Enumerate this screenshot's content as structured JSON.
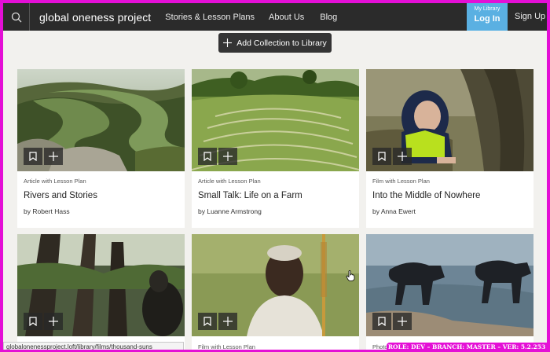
{
  "nav": {
    "logo": "global oneness project",
    "links": [
      "Stories & Lesson Plans",
      "About Us",
      "Blog"
    ],
    "library_label": "My Library",
    "login_label": "Log In",
    "signup_label": "Sign Up"
  },
  "toolbar": {
    "add_collection_label": "Add Collection to Library"
  },
  "cards": [
    {
      "type": "Article with Lesson Plan",
      "title": "Rivers and Stories",
      "author": "by Robert Hass"
    },
    {
      "type": "Article with Lesson Plan",
      "title": "Small Talk: Life on a Farm",
      "author": "by Luanne Armstrong"
    },
    {
      "type": "Film with Lesson Plan",
      "title": "Into the Middle of Nowhere",
      "author": "by Anna Ewert"
    },
    {
      "type": "",
      "title": "",
      "author": ""
    },
    {
      "type": "Film with Lesson Plan",
      "title": "",
      "author": ""
    },
    {
      "type": "Photo",
      "title": "",
      "author": ""
    }
  ],
  "status_bar": {
    "url": "globalonenessproject.loft/library/films/thousand-suns"
  },
  "dev_badge": {
    "text": "ROLE: DEV – BRANCH: MASTER – VER: 5.2.253"
  },
  "colors": {
    "accent": "#5ab0e2",
    "nav_bg": "#2b2b2b",
    "dev_frame": "#e40fd6"
  }
}
